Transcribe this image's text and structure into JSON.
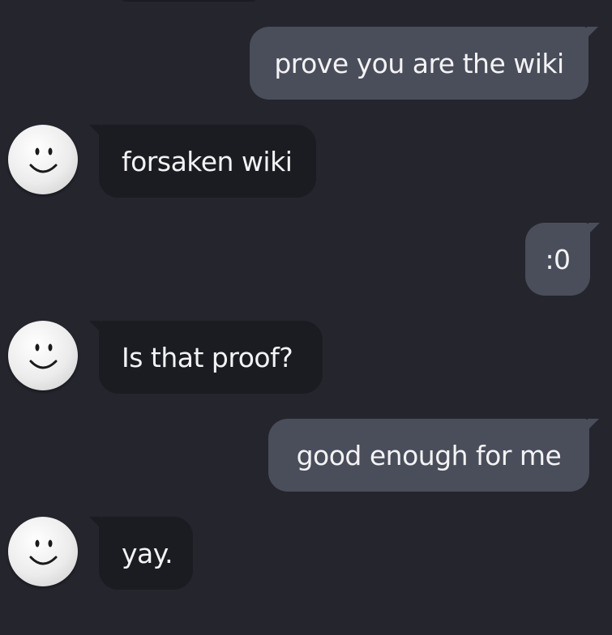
{
  "conversation": {
    "messages": [
      {
        "sender": "user",
        "text": "prove you are the wiki"
      },
      {
        "sender": "bot",
        "text": "forsaken wiki",
        "avatar_icon": "smiley-face-icon"
      },
      {
        "sender": "user",
        "text": ":0"
      },
      {
        "sender": "bot",
        "text": "Is that proof?",
        "avatar_icon": "smiley-face-icon"
      },
      {
        "sender": "user",
        "text": "good enough for me"
      },
      {
        "sender": "bot",
        "text": "yay.",
        "avatar_icon": "smiley-face-icon"
      }
    ]
  },
  "colors": {
    "background": "#24252d",
    "user_bubble": "#4a4e5a",
    "bot_bubble": "#1b1c22",
    "text": "#f3f3f5"
  }
}
